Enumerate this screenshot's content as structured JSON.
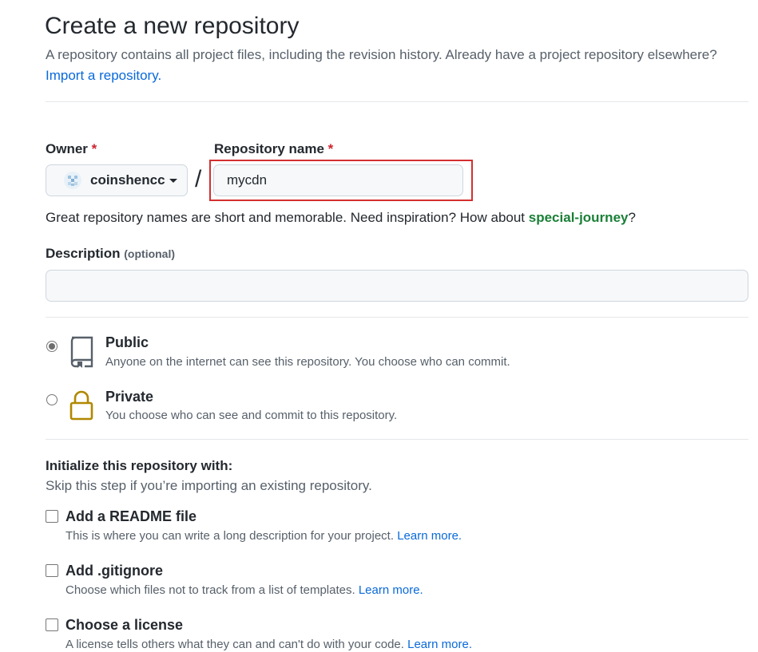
{
  "header": {
    "title": "Create a new repository",
    "subtitle": "A repository contains all project files, including the revision history. Already have a project repository elsewhere?",
    "import_link": "Import a repository."
  },
  "owner": {
    "label": "Owner",
    "required_mark": "*",
    "value": "coinshencc",
    "icon": "identicon-avatar"
  },
  "separator": "/",
  "repo_name": {
    "label": "Repository name",
    "required_mark": "*",
    "value": "mycdn",
    "highlight_color": "#d32f2f"
  },
  "name_hint": {
    "text": "Great repository names are short and memorable. Need inspiration? How about ",
    "suggestion": "special-journey",
    "suffix": "?"
  },
  "description": {
    "label": "Description",
    "optional": "(optional)",
    "value": ""
  },
  "visibility": [
    {
      "title": "Public",
      "description": "Anyone on the internet can see this repository. You choose who can commit.",
      "icon": "repo-icon",
      "checked": true
    },
    {
      "title": "Private",
      "description": "You choose who can see and commit to this repository.",
      "icon": "lock-icon",
      "checked": false
    }
  ],
  "initialize": {
    "title": "Initialize this repository with:",
    "subtitle": "Skip this step if you’re importing an existing repository.",
    "options": [
      {
        "title": "Add a README file",
        "description": "This is where you can write a long description for your project.",
        "link": "Learn more.",
        "checked": false
      },
      {
        "title": "Add .gitignore",
        "description": "Choose which files not to track from a list of templates.",
        "link": "Learn more.",
        "checked": false
      },
      {
        "title": "Choose a license",
        "description": "A license tells others what they can and can't do with your code.",
        "link": "Learn more.",
        "checked": false
      }
    ]
  },
  "colors": {
    "link": "#0969da",
    "suggestion": "#1a7f37",
    "required": "#cf222e",
    "lock_icon": "#b08800"
  }
}
